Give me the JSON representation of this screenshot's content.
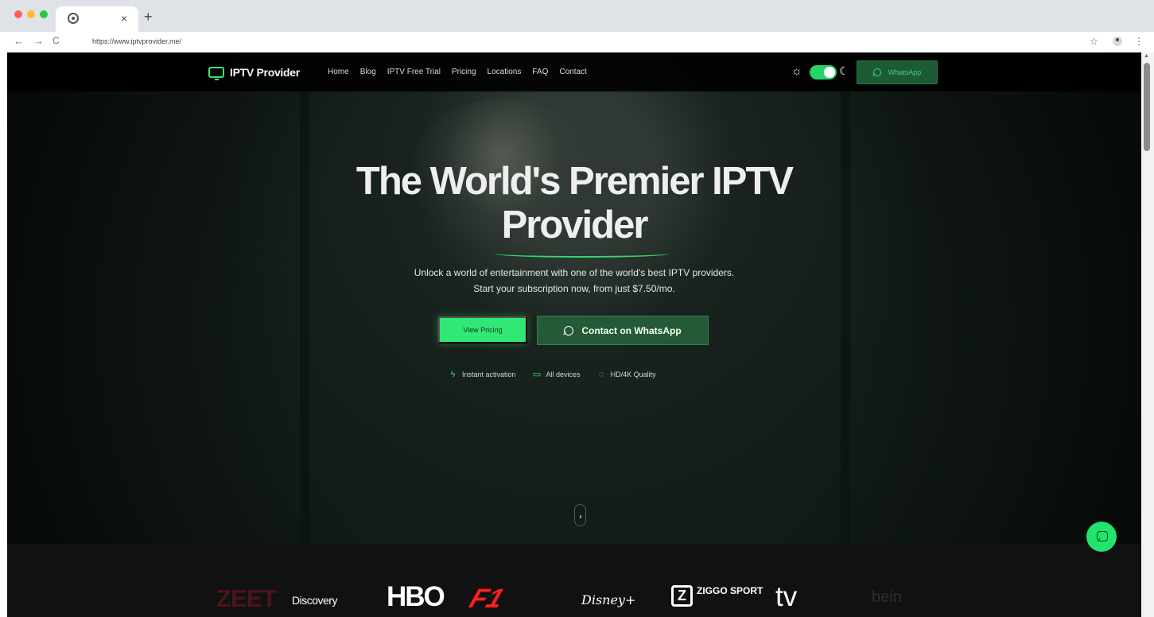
{
  "browser": {
    "tab_close": "×",
    "new_tab": "+",
    "back": "←",
    "forward": "→",
    "reload": "C",
    "url": "https://www.iptvprovider.me/",
    "star": "☆",
    "menu": "⋮"
  },
  "site": {
    "logo": "IPTV Provider",
    "nav": [
      "Home",
      "Blog",
      "IPTV Free Trial",
      "Pricing",
      "Locations",
      "FAQ",
      "Contact"
    ],
    "top_whatsapp": "WhatsApp",
    "toggle_state": "on"
  },
  "hero": {
    "title_line1": "The World's Premier IPTV",
    "title_line2": "Provider",
    "subtitle_line1": "Unlock a world of entertainment with one of the world's best IPTV providers.",
    "subtitle_line2": "Start your subscription now, from just $7.50/mo.",
    "primary_button": "View Pricing",
    "secondary_button": "Contact on WhatsApp",
    "features": [
      {
        "icon": "lightning-icon",
        "label": "Instant activation"
      },
      {
        "icon": "tv-icon",
        "label": "All devices"
      },
      {
        "icon": "shield-check-icon",
        "label": "HD/4K Quality"
      }
    ]
  },
  "brands": [
    "ZEET",
    "Discovery",
    "HBO",
    "F1",
    "Disney+",
    "ZIGGO SPORT",
    "tv",
    "bein"
  ],
  "colors": {
    "accent": "#31e877",
    "dark_background": "#000000",
    "whatsapp_green": "#245a35"
  }
}
